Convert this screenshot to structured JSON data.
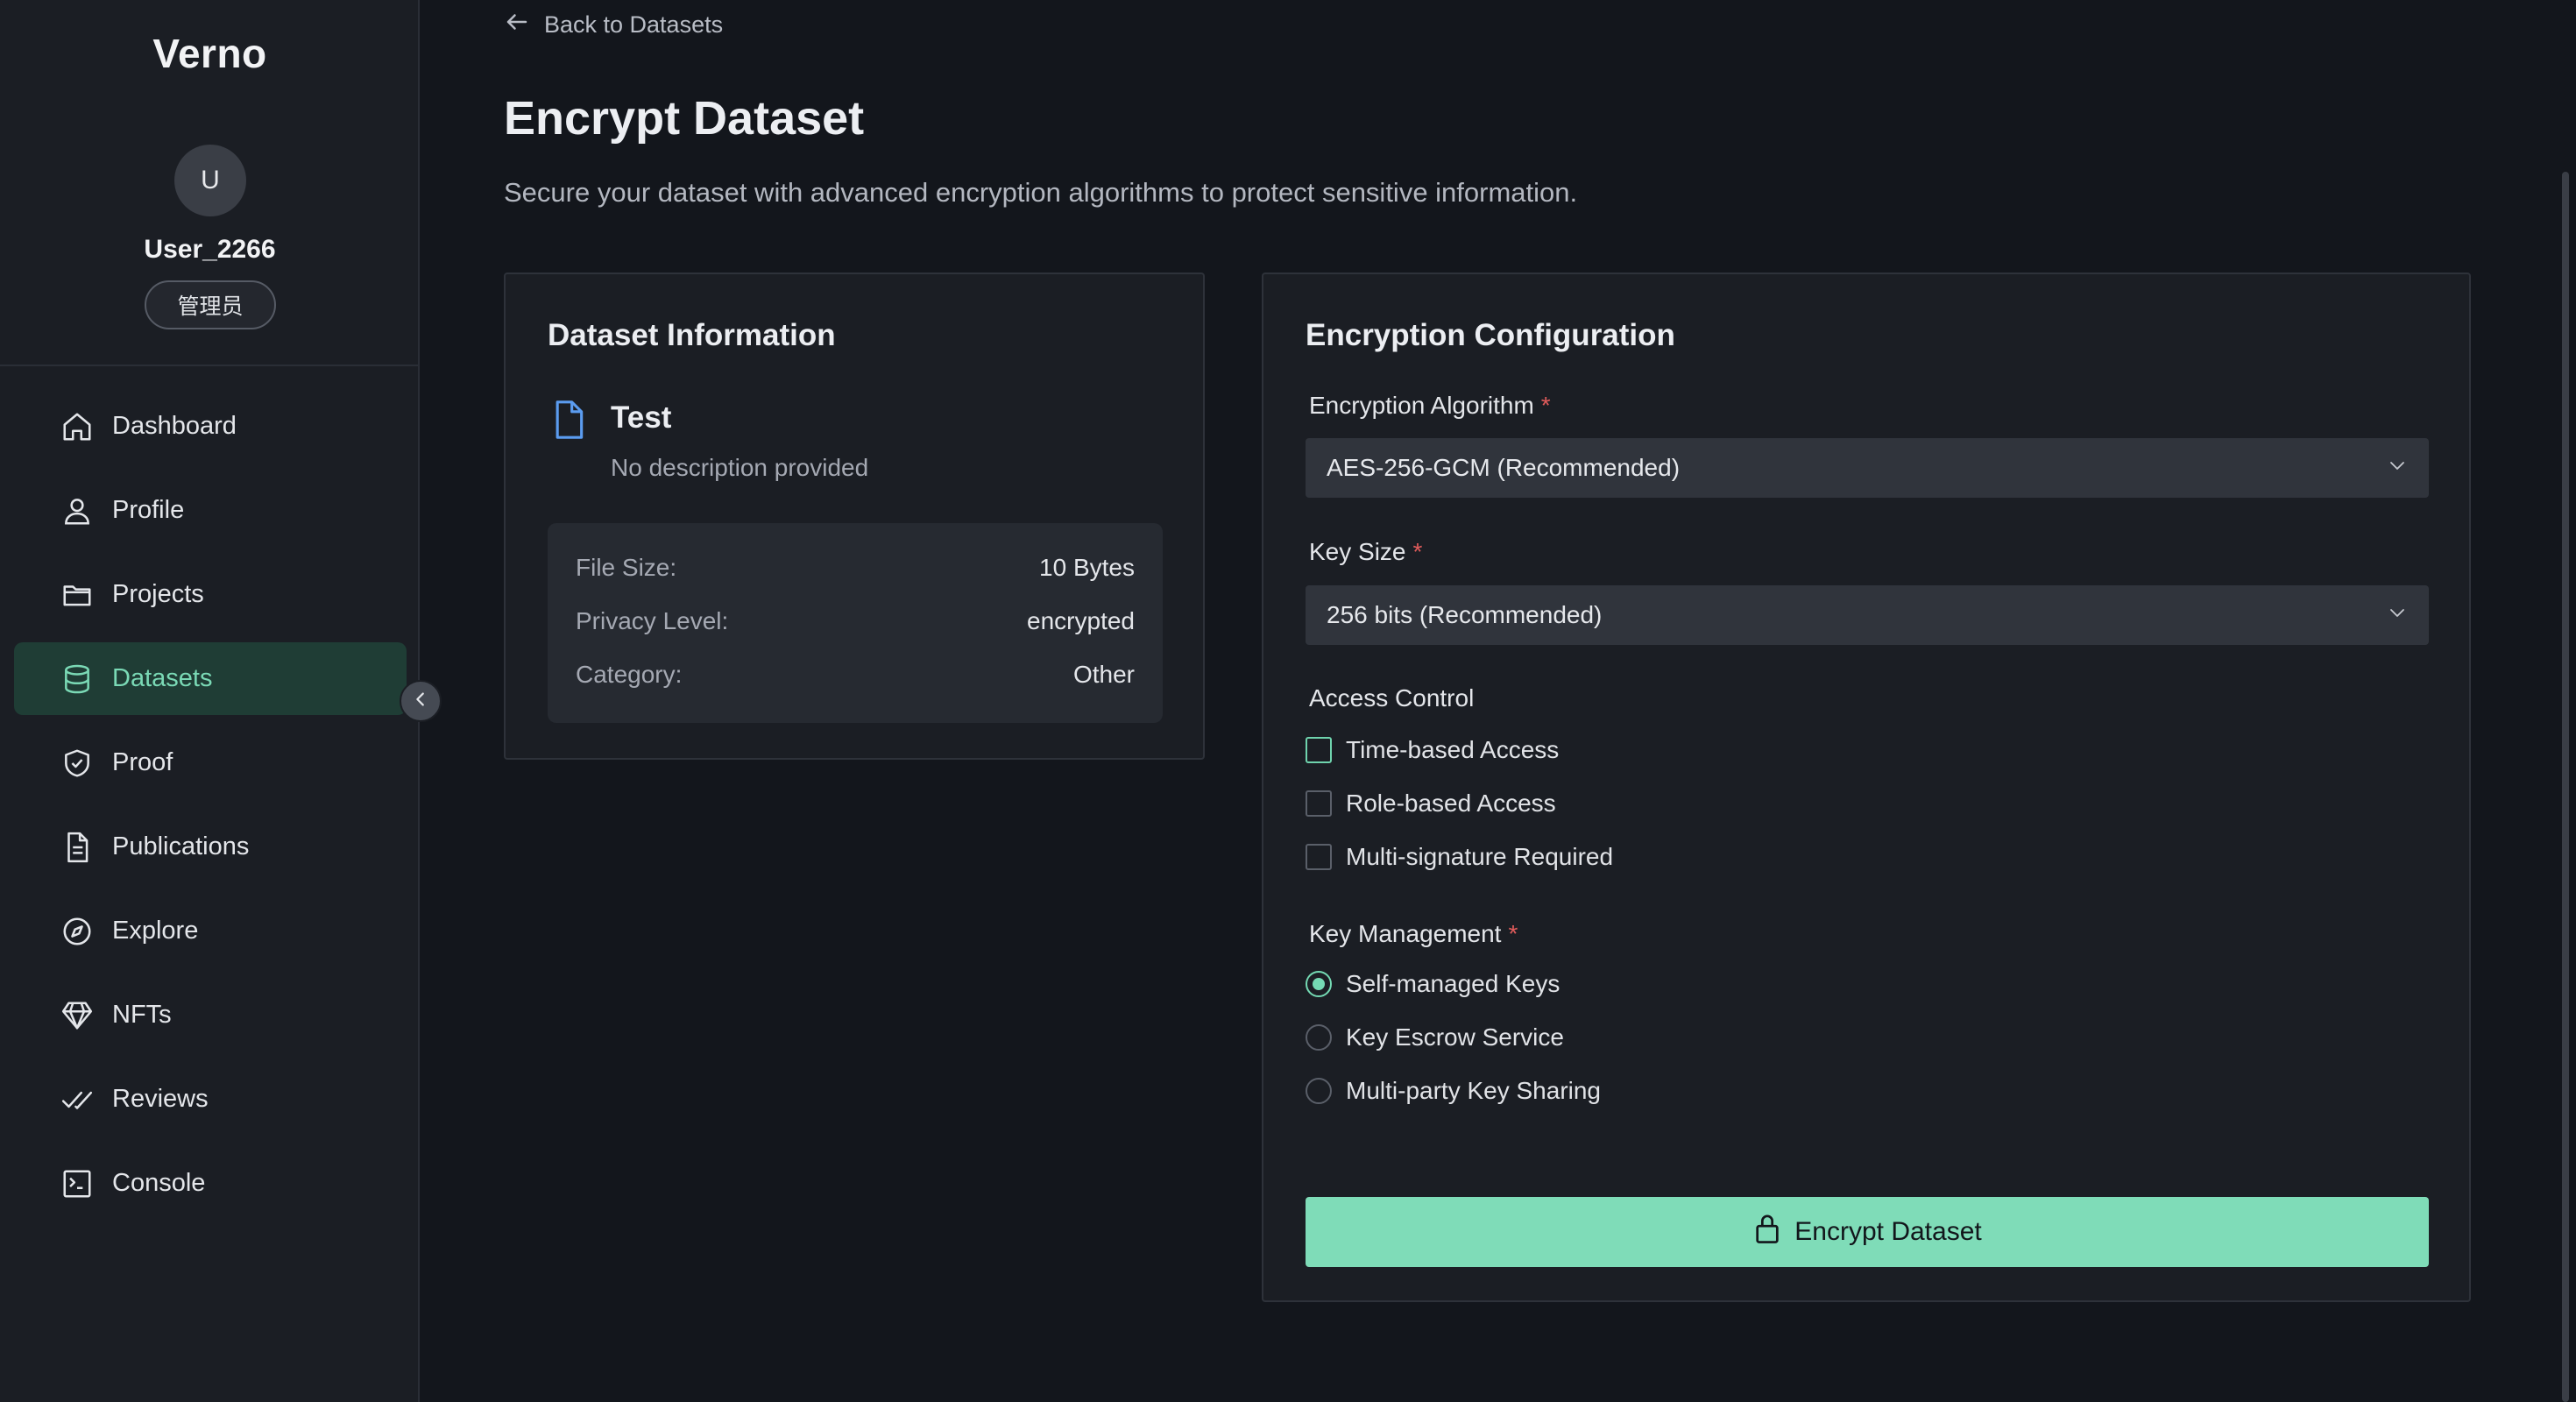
{
  "app": {
    "brand": "Verno"
  },
  "user": {
    "avatar_initial": "U",
    "name": "User_2266",
    "role": "管理员"
  },
  "sidebar": {
    "items": [
      {
        "label": "Dashboard",
        "icon": "home-icon"
      },
      {
        "label": "Profile",
        "icon": "user-icon"
      },
      {
        "label": "Projects",
        "icon": "folder-icon"
      },
      {
        "label": "Datasets",
        "icon": "database-icon",
        "active": true
      },
      {
        "label": "Proof",
        "icon": "shield-check-icon"
      },
      {
        "label": "Publications",
        "icon": "document-icon"
      },
      {
        "label": "Explore",
        "icon": "compass-icon"
      },
      {
        "label": "NFTs",
        "icon": "diamond-icon"
      },
      {
        "label": "Reviews",
        "icon": "double-check-icon"
      },
      {
        "label": "Console",
        "icon": "terminal-icon"
      }
    ]
  },
  "header": {
    "back_label": "Back to Datasets",
    "title": "Encrypt Dataset",
    "subtitle": "Secure your dataset with advanced encryption algorithms to protect sensitive information."
  },
  "dataset_info": {
    "title": "Dataset Information",
    "name": "Test",
    "description": "No description provided",
    "rows": [
      {
        "key": "File Size:",
        "value": "10 Bytes"
      },
      {
        "key": "Privacy Level:",
        "value": "encrypted"
      },
      {
        "key": "Category:",
        "value": "Other"
      }
    ]
  },
  "encryption": {
    "title": "Encryption Configuration",
    "algorithm_label": "Encryption Algorithm",
    "algorithm_value": "AES-256-GCM (Recommended)",
    "key_size_label": "Key Size",
    "key_size_value": "256 bits (Recommended)",
    "required_mark": "*",
    "access_control_label": "Access Control",
    "access_options": [
      {
        "label": "Time-based Access",
        "checked": false
      },
      {
        "label": "Role-based Access",
        "checked": false
      },
      {
        "label": "Multi-signature Required",
        "checked": false
      }
    ],
    "key_management_label": "Key Management",
    "key_management_options": [
      {
        "label": "Self-managed Keys",
        "selected": true
      },
      {
        "label": "Key Escrow Service",
        "selected": false
      },
      {
        "label": "Multi-party Key Sharing",
        "selected": false
      }
    ],
    "submit_label": "Encrypt Dataset"
  },
  "colors": {
    "accent": "#7fdcb8",
    "active_nav_bg": "#1f3d35",
    "required": "#e05b5b"
  }
}
